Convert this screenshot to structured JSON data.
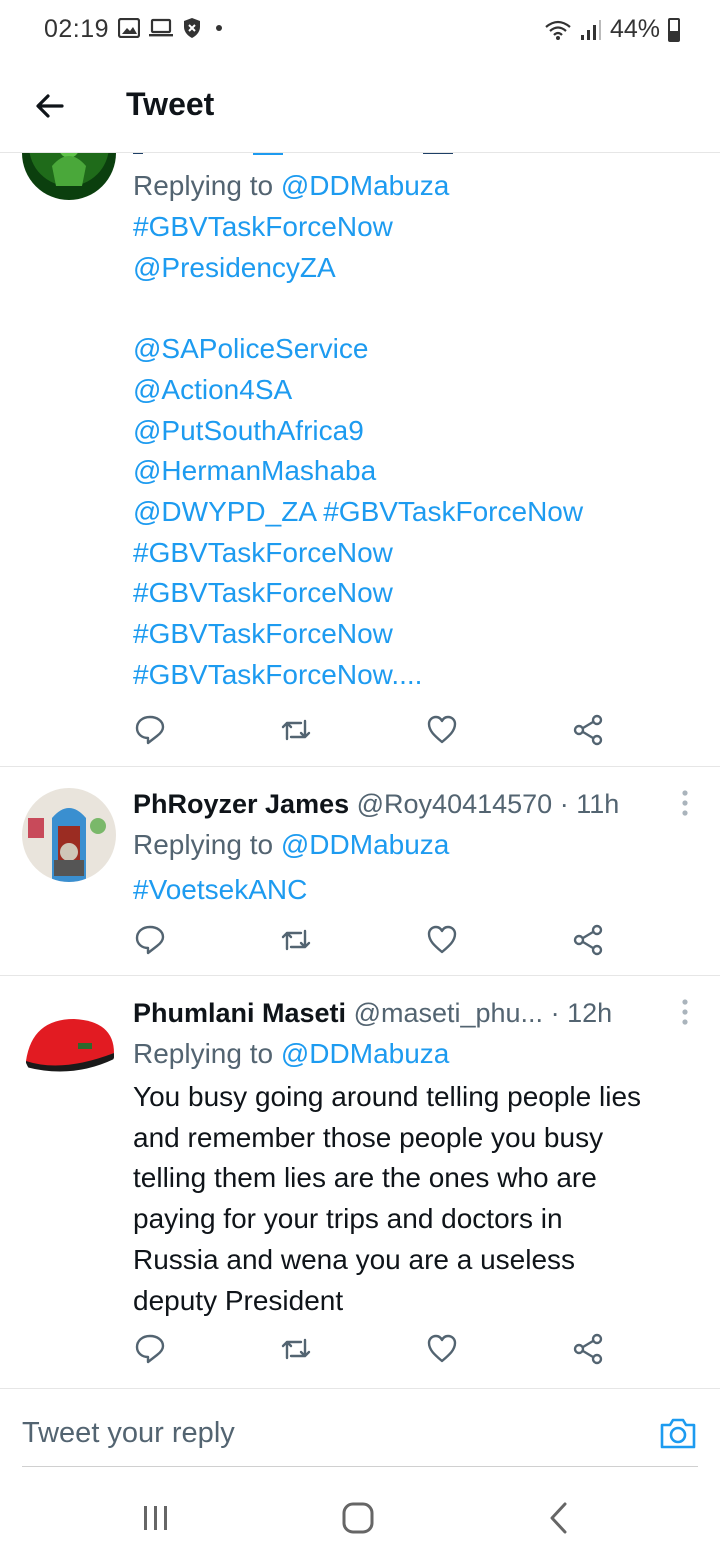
{
  "status_bar": {
    "time": "02:19",
    "battery": "44%",
    "battery_level": 0.44,
    "left_icons": [
      "gallery-icon",
      "laptop-icon",
      "shield-icon"
    ],
    "right_icons": [
      "wifi-icon",
      "signal-icon",
      "battery-icon"
    ]
  },
  "header": {
    "title": "Tweet",
    "back_icon": "arrow-left-icon"
  },
  "tweets": [
    {
      "reply_prefix": "Replying to ",
      "reply_to": "@DDMabuza",
      "body_lines": [
        "#GBVTaskForceNow",
        "@PresidencyZA",
        "",
        "@SAPoliceService",
        "@Action4SA",
        "@PutSouthAfrica9",
        "@HermanMashaba",
        "@DWYPD_ZA #GBVTaskForceNow",
        "#GBVTaskForceNow",
        "#GBVTaskForceNow",
        "#GBVTaskForceNow",
        "#GBVTaskForceNow...."
      ]
    },
    {
      "name": "PhRoyzer James",
      "handle": "@Roy40414570",
      "separator": " · ",
      "time": "11h",
      "reply_prefix": "Replying to ",
      "reply_to": "@DDMabuza",
      "body_lines": [
        "#VoetsekANC"
      ]
    },
    {
      "name": "Phumlani Maseti",
      "handle": "@maseti_phu...",
      "separator": " · ",
      "time": "12h",
      "reply_prefix": "Replying to ",
      "reply_to": "@DDMabuza",
      "body_lines": [
        "You busy going around telling people lies",
        "and remember those people you busy",
        "telling them lies are the ones who are",
        "paying for your trips and doctors in",
        "Russia and wena you are a useless",
        "deputy President"
      ]
    }
  ],
  "reply_box": {
    "placeholder": "Tweet your reply",
    "camera_icon": "camera-icon"
  },
  "colors": {
    "link": "#1d9bf0",
    "secondary_text": "#536471",
    "primary_text": "#0f1419",
    "divider": "#e6e6e6"
  }
}
